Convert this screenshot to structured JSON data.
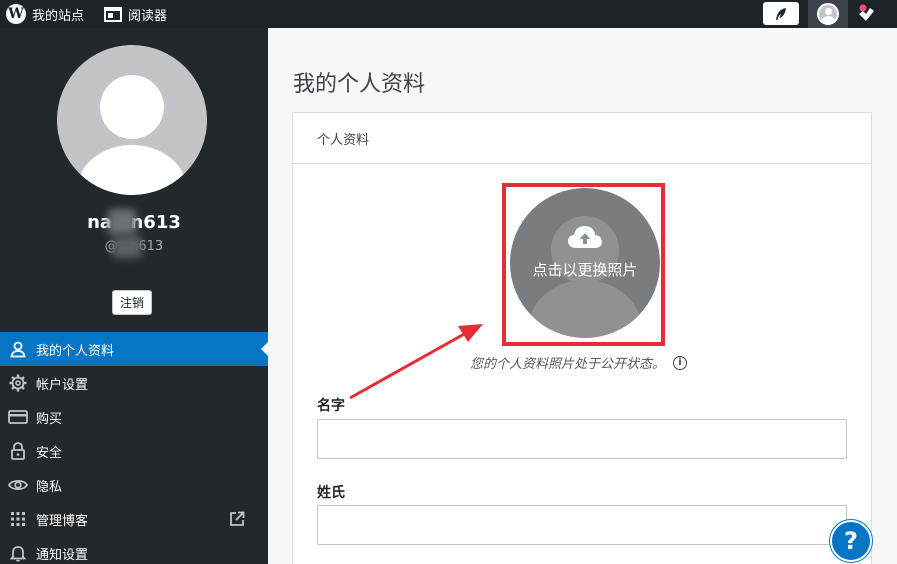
{
  "topbar": {
    "my_site": "我的站点",
    "reader": "阅读器",
    "icons": [
      "wordpress-logo-icon",
      "reader-icon",
      "write-icon",
      "avatar-icon",
      "notifications-icon"
    ]
  },
  "sidebar": {
    "display_name": "na    an613",
    "username": "@n      n613",
    "logout_label": "注销",
    "items": [
      {
        "label": "我的个人资料",
        "icon": "person-icon",
        "active": true
      },
      {
        "label": "帐户设置",
        "icon": "gear-icon"
      },
      {
        "label": "购买",
        "icon": "credit-card-icon"
      },
      {
        "label": "安全",
        "icon": "lock-icon"
      },
      {
        "label": "隐私",
        "icon": "eye-icon"
      },
      {
        "label": "管理博客",
        "icon": "grid-icon",
        "external": true
      },
      {
        "label": "通知设置",
        "icon": "bell-icon"
      }
    ]
  },
  "main": {
    "page_title": "我的个人资料",
    "card_title": "个人资料",
    "photo_label": "点击以更换照片",
    "photo_hint": "您的个人资料照片处于公开状态。",
    "first_name_label": "名字",
    "first_name_value": "",
    "last_name_label": "姓氏",
    "last_name_value": ""
  },
  "help": {
    "label": "?"
  },
  "colors": {
    "topbar": "#1d2327",
    "sidebar": "#23282d",
    "accent": "#0675c4",
    "highlight_red": "#e62c34"
  }
}
